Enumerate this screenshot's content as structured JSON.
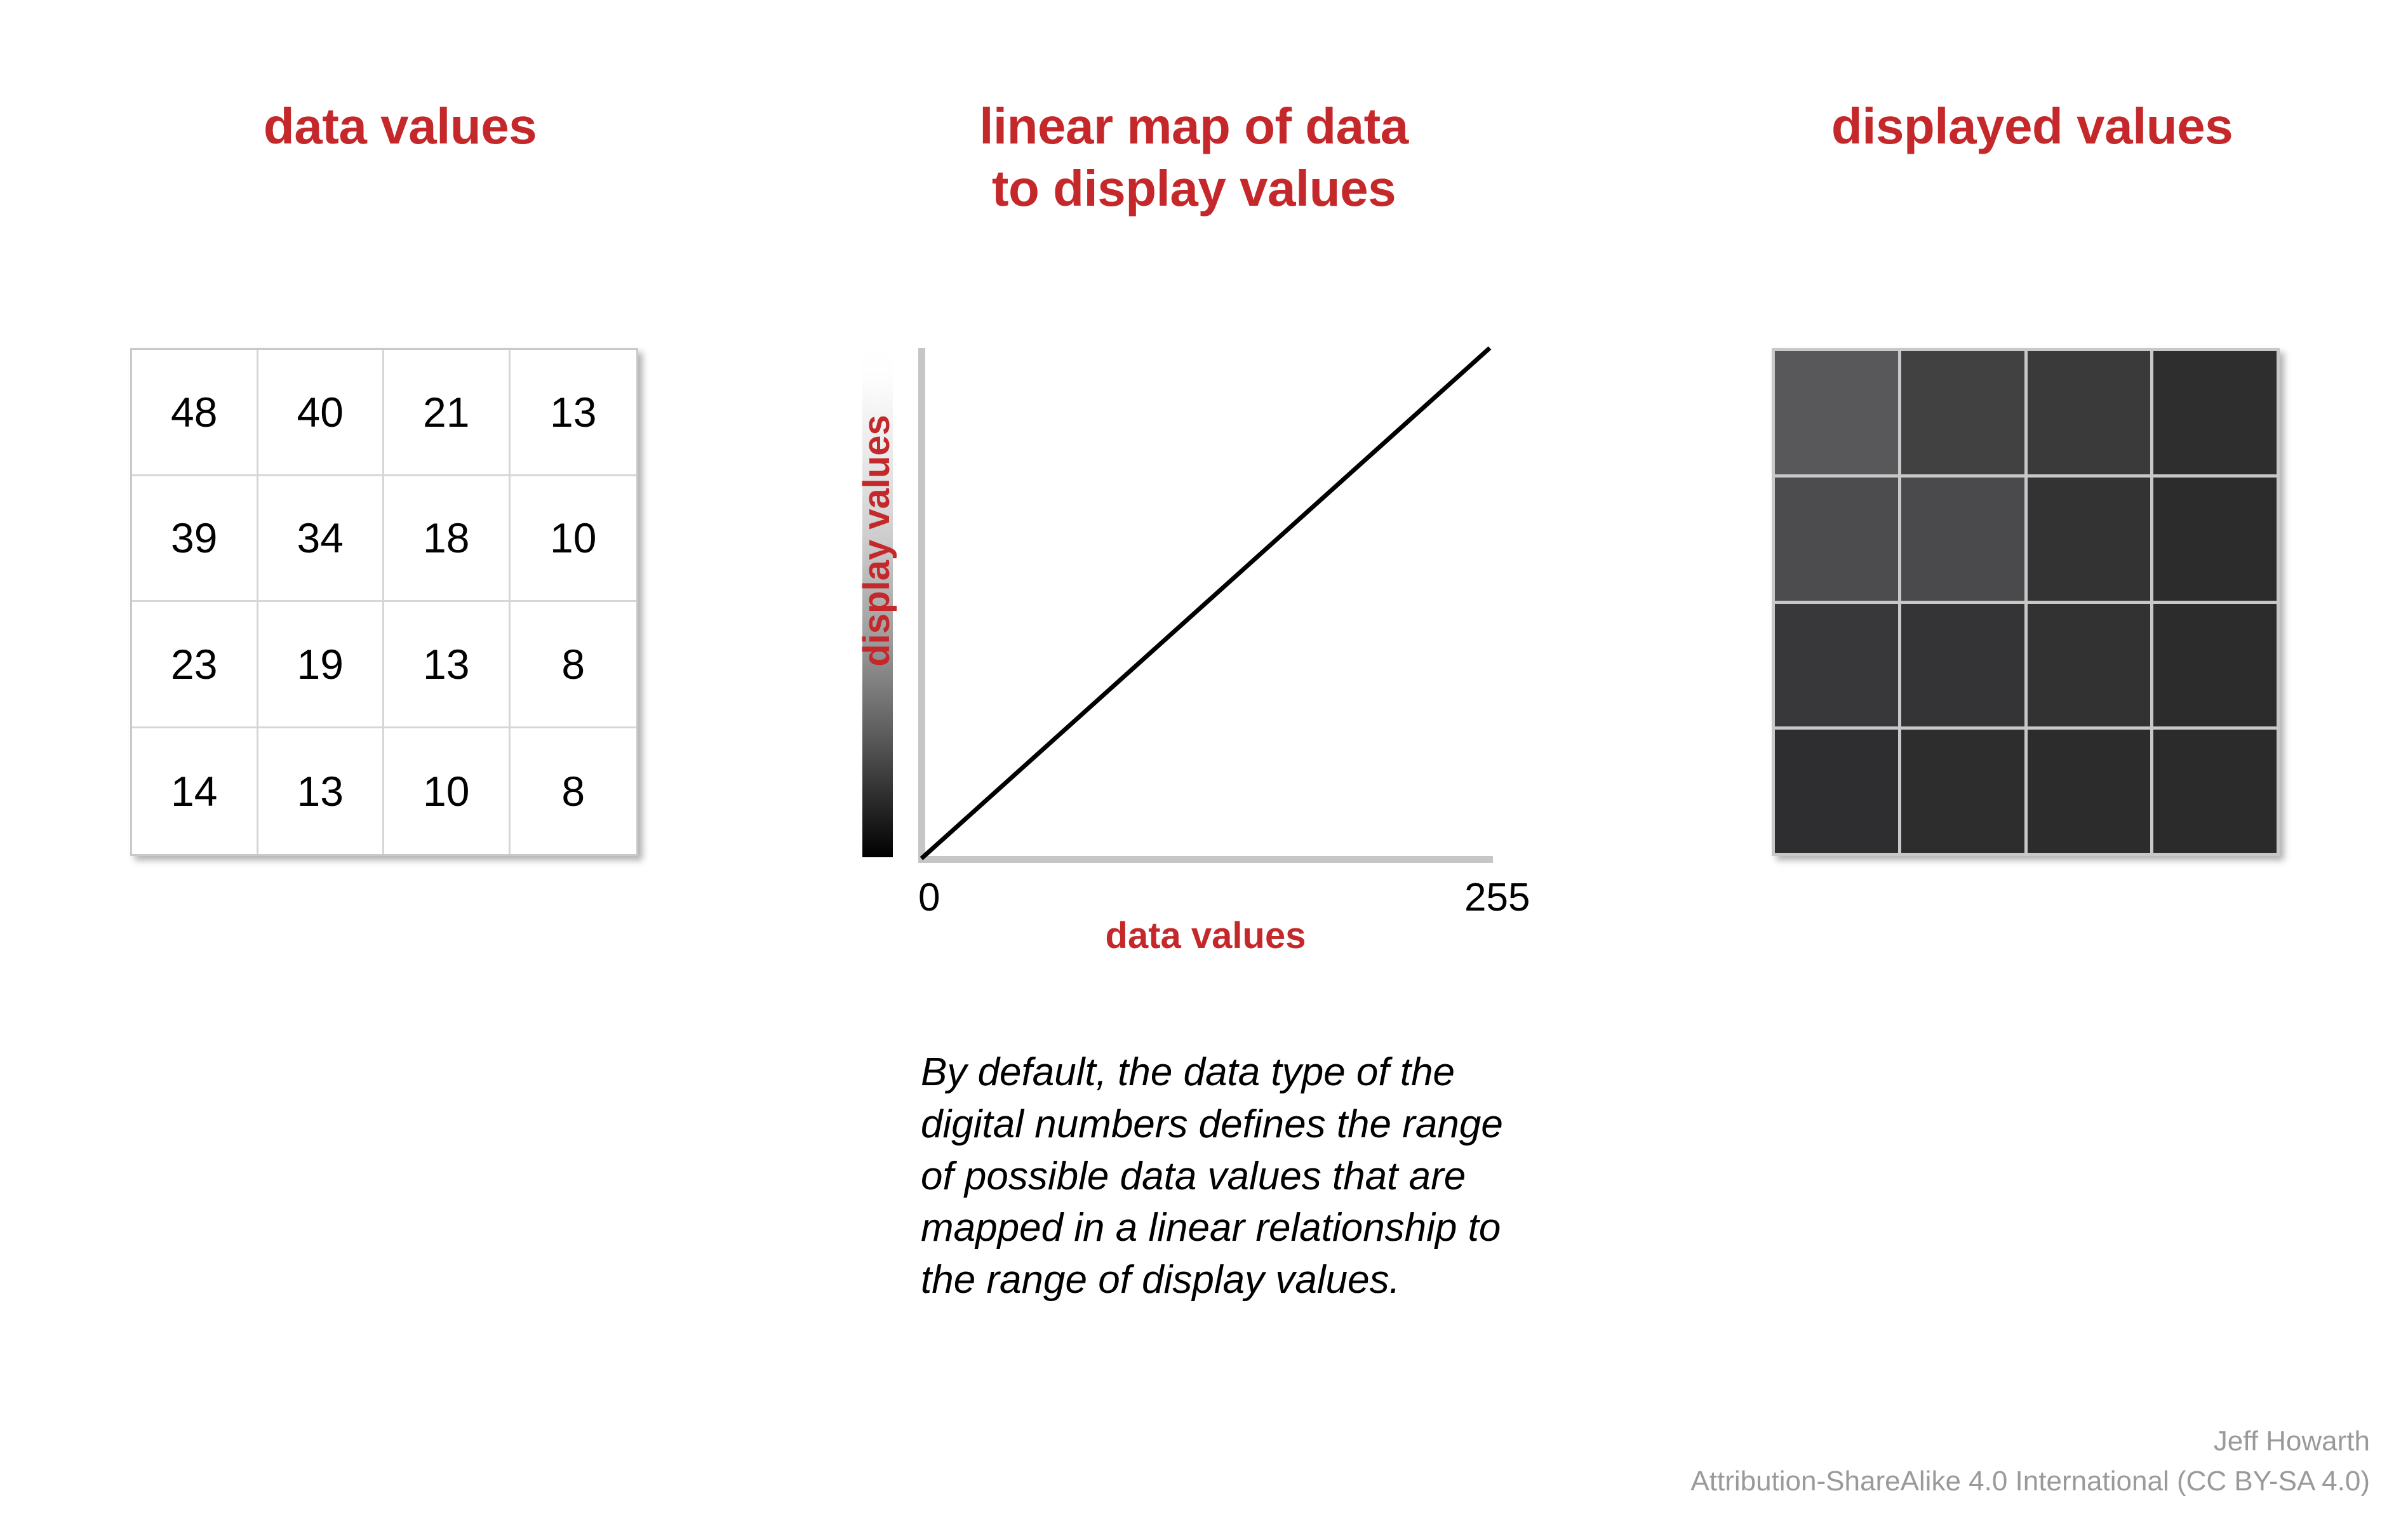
{
  "titles": {
    "left": "data values",
    "middle_line1": "linear map of data",
    "middle_line2": "to display values",
    "right": "displayed values"
  },
  "colors": {
    "accent_red": "#c5282a",
    "axis_gray": "#c6c6c6",
    "grid_border": "#c9c9c9",
    "footer_gray": "#9a9a9a"
  },
  "data_grid": {
    "rows": [
      [
        "48",
        "40",
        "21",
        "13"
      ],
      [
        "39",
        "34",
        "18",
        "10"
      ],
      [
        "23",
        "19",
        "13",
        "8"
      ],
      [
        "14",
        "13",
        "10",
        "8"
      ]
    ]
  },
  "display_grid": {
    "rows": [
      [
        "#58585a",
        "#414142",
        "#3a3a3b",
        "#2e2e2f"
      ],
      [
        "#4c4c4e",
        "#4a4a4c",
        "#333334",
        "#2c2c2d"
      ],
      [
        "#38383a",
        "#343436",
        "#323233",
        "#2c2c2d"
      ],
      [
        "#2e2e30",
        "#2d2d2e",
        "#2c2c2d",
        "#2b2b2c"
      ]
    ]
  },
  "plot": {
    "y_axis_label": "display values",
    "x_axis_label": "data values",
    "x_tick_min": "0",
    "x_tick_max": "255"
  },
  "caption": "By default, the data type of the digital numbers defines the range of possible data values that are mapped in a linear relationship to the range of display values.",
  "footer": {
    "author": "Jeff Howarth",
    "license": "Attribution-ShareAlike 4.0 International (CC BY-SA 4.0)"
  },
  "chart_data": {
    "type": "line",
    "title": "linear map of data to display values",
    "xlabel": "data values",
    "ylabel": "display values",
    "xlim": [
      0,
      255
    ],
    "ylim": [
      0,
      255
    ],
    "xticks": [
      "0",
      "255"
    ],
    "yticks": [],
    "grid": false,
    "legend": null,
    "series": [
      {
        "name": "linear map",
        "x": [
          0,
          255
        ],
        "y": [
          0,
          255
        ]
      }
    ],
    "colorbar": {
      "orientation": "vertical",
      "from": "#000000",
      "to": "#ffffff",
      "label": "display values"
    },
    "annotations": []
  }
}
